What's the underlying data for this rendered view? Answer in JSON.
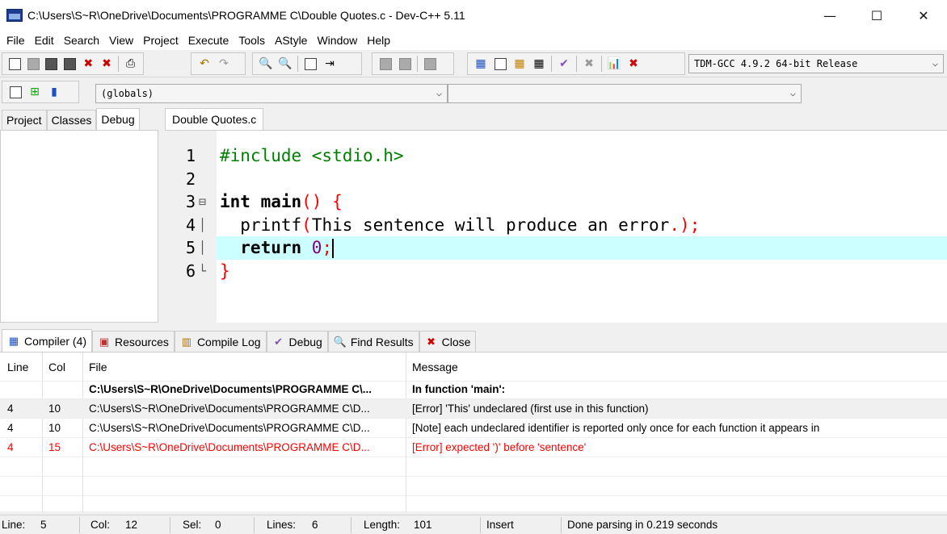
{
  "window": {
    "title": "C:\\Users\\S~R\\OneDrive\\Documents\\PROGRAMME C\\Double Quotes.c - Dev-C++ 5.11",
    "minimize": "—",
    "maximize": "☐",
    "close": "✕"
  },
  "menu": [
    "File",
    "Edit",
    "Search",
    "View",
    "Project",
    "Execute",
    "Tools",
    "AStyle",
    "Window",
    "Help"
  ],
  "toolbar": {
    "compiler_select": "TDM-GCC 4.9.2 64-bit Release",
    "scope_select": "(globals)",
    "function_select": ""
  },
  "left_panel": {
    "tabs": [
      "Project",
      "Classes",
      "Debug"
    ],
    "active_tab": "Debug"
  },
  "editor": {
    "tab": "Double Quotes.c",
    "lines": [
      {
        "num": "1",
        "fold": ""
      },
      {
        "num": "2",
        "fold": ""
      },
      {
        "num": "3",
        "fold": "⊟"
      },
      {
        "num": "4",
        "fold": "│"
      },
      {
        "num": "5",
        "fold": "│"
      },
      {
        "num": "6",
        "fold": "└"
      }
    ],
    "code": {
      "l1_pp": "#include <stdio.h>",
      "l3_kw": "int",
      "l3_ident": " main",
      "l3_sym": "() {",
      "l4_ident": "  printf",
      "l4_sym1": "(",
      "l4_text": "This sentence will produce an error",
      "l4_sym2": ".);",
      "l5_kw": "  return",
      "l5_num": " 0",
      "l5_sym": ";",
      "l6_sym": "}"
    },
    "current_line": 5
  },
  "bottom_tabs": [
    {
      "label": "Compiler (4)",
      "icon": "grid-icon",
      "active": true
    },
    {
      "label": "Resources",
      "icon": "resources-icon",
      "active": false
    },
    {
      "label": "Compile Log",
      "icon": "chart-icon",
      "active": false
    },
    {
      "label": "Debug",
      "icon": "check-icon",
      "active": false
    },
    {
      "label": "Find Results",
      "icon": "find-icon",
      "active": false
    },
    {
      "label": "Close",
      "icon": "close-icon",
      "active": false
    }
  ],
  "compiler": {
    "headers": {
      "line": "Line",
      "col": "Col",
      "file": "File",
      "message": "Message"
    },
    "rows": [
      {
        "line": "",
        "col": "",
        "file": "C:\\Users\\S~R\\OneDrive\\Documents\\PROGRAMME C\\...",
        "message": "In function 'main':",
        "style": "bold"
      },
      {
        "line": "4",
        "col": "10",
        "file": "C:\\Users\\S~R\\OneDrive\\Documents\\PROGRAMME C\\D...",
        "message": "[Error] 'This' undeclared (first use in this function)",
        "style": "sel"
      },
      {
        "line": "4",
        "col": "10",
        "file": "C:\\Users\\S~R\\OneDrive\\Documents\\PROGRAMME C\\D...",
        "message": "[Note] each undeclared identifier is reported only once for each function it appears in",
        "style": "normal"
      },
      {
        "line": "4",
        "col": "15",
        "file": "C:\\Users\\S~R\\OneDrive\\Documents\\PROGRAMME C\\D...",
        "message": "[Error] expected ')' before 'sentence'",
        "style": "err"
      }
    ]
  },
  "status": {
    "line_label": "Line:",
    "line_val": "5",
    "col_label": "Col:",
    "col_val": "12",
    "sel_label": "Sel:",
    "sel_val": "0",
    "lines_label": "Lines:",
    "lines_val": "6",
    "length_label": "Length:",
    "length_val": "101",
    "mode": "Insert",
    "message": "Done parsing in 0.219 seconds"
  }
}
